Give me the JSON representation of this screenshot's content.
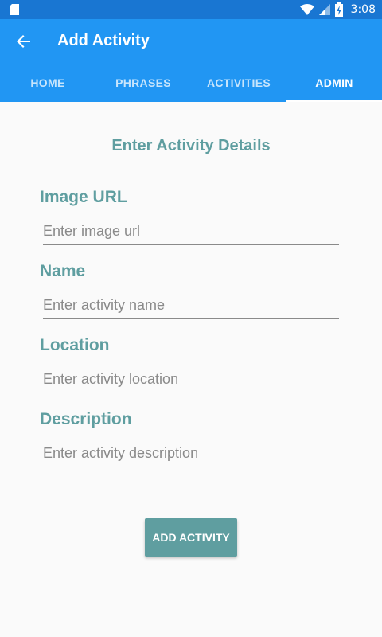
{
  "status_bar": {
    "time": "3:08",
    "icons": [
      "sd-card-icon",
      "wifi-icon",
      "cell-signal-icon",
      "battery-charging-icon"
    ]
  },
  "app_bar": {
    "title": "Add Activity",
    "back_icon": "arrow-back-icon"
  },
  "tabs": [
    {
      "label": "HOME",
      "active": false
    },
    {
      "label": "PHRASES",
      "active": false
    },
    {
      "label": "ACTIVITIES",
      "active": false
    },
    {
      "label": "ADMIN",
      "active": true
    }
  ],
  "form": {
    "title": "Enter Activity Details",
    "fields": [
      {
        "label": "Image URL",
        "placeholder": "Enter image url",
        "value": ""
      },
      {
        "label": "Name",
        "placeholder": "Enter activity name",
        "value": ""
      },
      {
        "label": "Location",
        "placeholder": "Enter activity location",
        "value": ""
      },
      {
        "label": "Description",
        "placeholder": "Enter activity description",
        "value": ""
      }
    ],
    "submit_label": "ADD ACTIVITY"
  },
  "colors": {
    "status_bar": "#1976d2",
    "app_bar": "#2196f3",
    "accent": "#5f9ea0",
    "background": "#fafafa"
  }
}
